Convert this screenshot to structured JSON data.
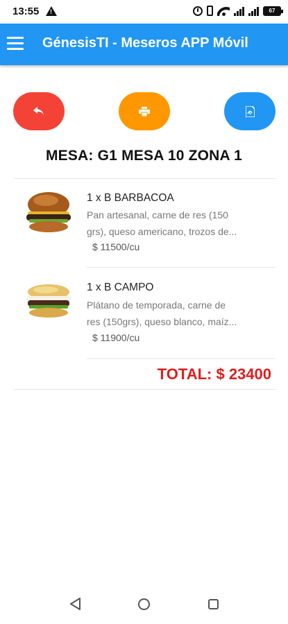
{
  "status_bar": {
    "time": "13:55",
    "battery": "67",
    "icons": [
      "warning-icon",
      "alarm-icon",
      "vibrate-icon",
      "wifi-icon",
      "signal-icon",
      "signal-icon",
      "battery-icon"
    ]
  },
  "app_bar": {
    "title": "GénesisTI - Meseros APP Móvil",
    "menu_icon": "menu-icon"
  },
  "actions": {
    "back_icon": "reply-icon",
    "print_icon": "printer-icon",
    "pdf_icon": "pdf-file-icon",
    "colors": {
      "back": "#f44336",
      "print": "#ff9800",
      "pdf": "#2196f3"
    }
  },
  "table_title": "MESA: G1 MESA 10 ZONA 1",
  "items": [
    {
      "name": "1 x B BARBACOA",
      "desc_line1": "Pan artesanal, carne de res (150",
      "desc_line2": "grs), queso americano, trozos de...",
      "price": "$ 11500/cu"
    },
    {
      "name": "1 x B CAMPO",
      "desc_line1": "Plátano de temporada, carne de",
      "desc_line2": "res (150grs), queso blanco, maíz...",
      "price": "$ 11900/cu"
    }
  ],
  "total": "TOTAL: $ 23400",
  "colors": {
    "accent": "#2196f3",
    "total": "#e01e1e"
  }
}
